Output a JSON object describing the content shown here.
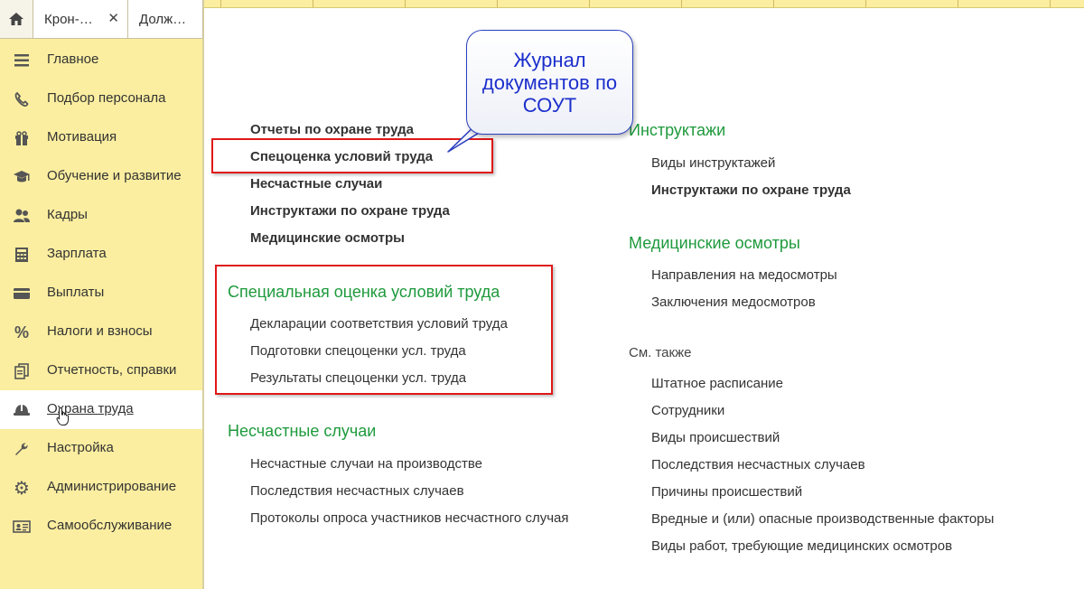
{
  "tabs": {
    "home_icon": "home-icon",
    "open": [
      {
        "label": "Крон-…",
        "close": "✕"
      },
      {
        "label": "Долж…"
      }
    ]
  },
  "sidebar": {
    "items": [
      {
        "label": "Главное",
        "icon": "menu-lines-icon"
      },
      {
        "label": "Подбор персонала",
        "icon": "phone-icon"
      },
      {
        "label": "Мотивация",
        "icon": "gift-icon"
      },
      {
        "label": "Обучение и развитие",
        "icon": "graduation-cap-icon"
      },
      {
        "label": "Кадры",
        "icon": "people-icon"
      },
      {
        "label": "Зарплата",
        "icon": "calculator-icon"
      },
      {
        "label": "Выплаты",
        "icon": "wallet-icon"
      },
      {
        "label": "Налоги и взносы",
        "icon": "percent-icon"
      },
      {
        "label": "Отчетность, справки",
        "icon": "documents-icon"
      },
      {
        "label": "Охрана труда",
        "icon": "hard-hat-icon",
        "active": true
      },
      {
        "label": "Настройка",
        "icon": "wrench-icon"
      },
      {
        "label": "Администрирование",
        "icon": "gear-icon"
      },
      {
        "label": "Самообслуживание",
        "icon": "id-card-icon"
      }
    ]
  },
  "main": {
    "top_links": [
      "Отчеты по охране труда",
      "Спецоценка условий труда",
      "Несчастные случаи",
      "Инструктажи по охране труда",
      "Медицинские осмотры"
    ],
    "sout": {
      "title": "Специальная оценка условий труда",
      "items": [
        "Декларации соответствия условий труда",
        "Подготовки спецоценки усл. труда",
        "Результаты спецоценки усл. труда"
      ]
    },
    "accidents": {
      "title": "Несчастные случаи",
      "items": [
        "Несчастные случаи на производстве",
        "Последствия несчастных случаев",
        "Протоколы опроса участников несчастного случая"
      ]
    },
    "briefings": {
      "title": "Инструктажи",
      "items": [
        "Виды инструктажей",
        "Инструктажи по охране труда"
      ]
    },
    "medical": {
      "title": "Медицинские осмотры",
      "items": [
        "Направления на медосмотры",
        "Заключения медосмотров"
      ]
    },
    "see_also": {
      "title": "См. также",
      "items": [
        "Штатное расписание",
        "Сотрудники",
        "Виды происшествий",
        "Последствия несчастных случаев",
        "Причины происшествий",
        "Вредные и (или) опасные производственные факторы",
        "Виды работ, требующие медицинских осмотров"
      ]
    }
  },
  "callout": {
    "text": "Журнал документов по СОУТ"
  },
  "colors": {
    "sidebar_bg": "#fbeea0",
    "group_title": "#1e9a3c",
    "highlight_box": "#e01818",
    "callout_text": "#1c2fcc"
  }
}
